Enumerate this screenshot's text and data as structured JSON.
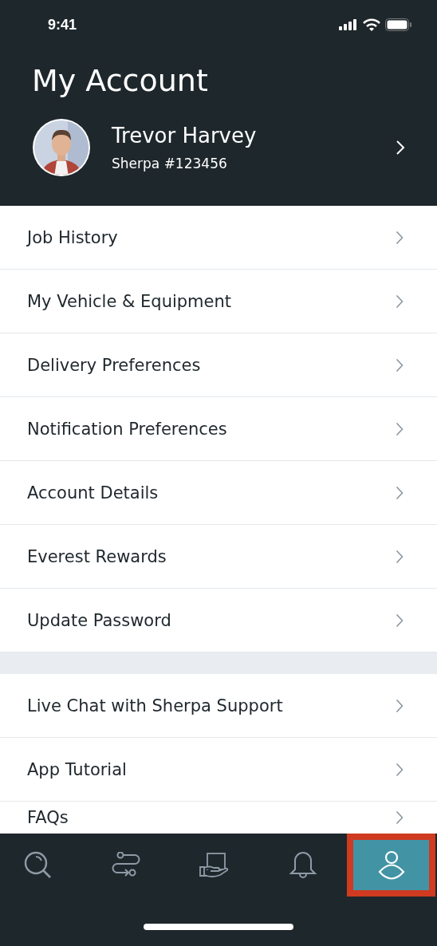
{
  "status_bar": {
    "time": "9:41"
  },
  "header": {
    "title": "My Account",
    "profile": {
      "name": "Trevor Harvey",
      "id": "Sherpa #123456"
    }
  },
  "sections": [
    {
      "items": [
        {
          "label": "Job History"
        },
        {
          "label": "My Vehicle & Equipment"
        },
        {
          "label": "Delivery Preferences"
        },
        {
          "label": "Notification Preferences"
        },
        {
          "label": "Account Details"
        },
        {
          "label": "Everest Rewards"
        },
        {
          "label": "Update Password"
        }
      ]
    },
    {
      "items": [
        {
          "label": "Live Chat with Sherpa Support"
        },
        {
          "label": "App Tutorial"
        },
        {
          "label": "FAQs"
        }
      ]
    }
  ],
  "tab_bar": [
    {
      "kind": "search",
      "selected": false
    },
    {
      "kind": "route",
      "selected": false
    },
    {
      "kind": "delivery",
      "selected": false
    },
    {
      "kind": "notifications",
      "selected": false
    },
    {
      "kind": "account",
      "selected": true
    }
  ]
}
